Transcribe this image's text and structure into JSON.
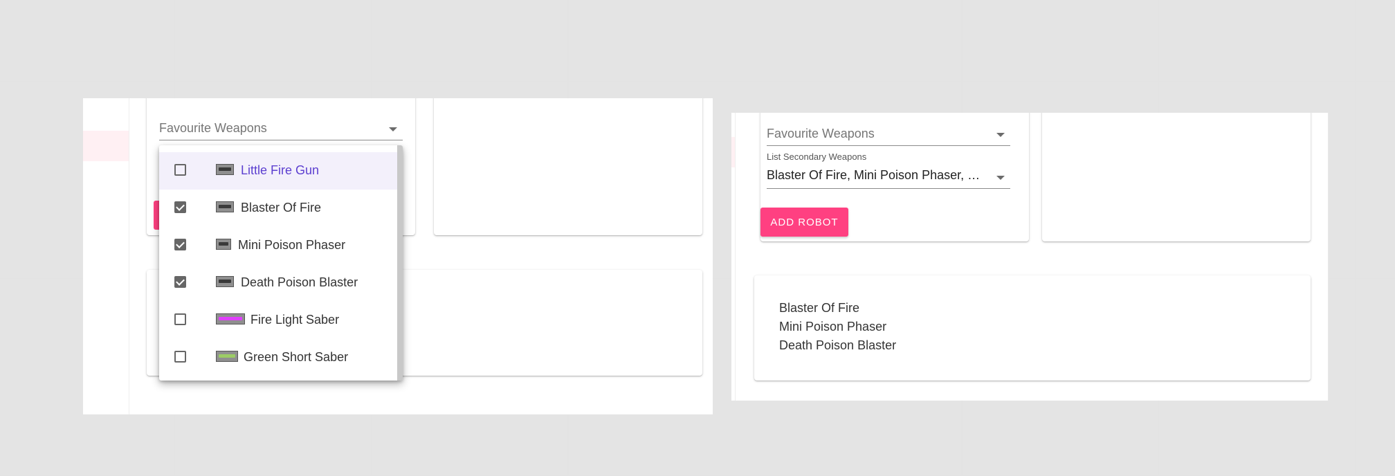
{
  "left_view": {
    "favourite_label": "Favourite Weapons",
    "weapon_menu": {
      "items": [
        {
          "label": "Little Fire Gun",
          "checked": false,
          "icon": "gun-icon",
          "highlighted": true
        },
        {
          "label": "Blaster Of Fire",
          "checked": true,
          "icon": "blaster-icon",
          "highlighted": false
        },
        {
          "label": "Mini Poison Phaser",
          "checked": true,
          "icon": "phaser-icon",
          "highlighted": false
        },
        {
          "label": "Death Poison Blaster",
          "checked": true,
          "icon": "blaster-icon",
          "highlighted": false
        },
        {
          "label": "Fire Light Saber",
          "checked": false,
          "icon": "pink-saber-icon",
          "highlighted": false
        },
        {
          "label": "Green Short Saber",
          "checked": false,
          "icon": "green-saber-icon",
          "highlighted": false
        }
      ]
    }
  },
  "right_view": {
    "favourite_label": "Favourite Weapons",
    "secondary_label": "List Secondary Weapons",
    "secondary_value": "Blaster Of Fire, Mini Poison Phaser, Death Poison Blaster",
    "add_button": "ADD ROBOT",
    "selected_list": [
      "Blaster Of Fire",
      "Mini Poison Phaser",
      "Death Poison Blaster"
    ]
  },
  "colors": {
    "accent": "#ff4081",
    "highlight_text": "#5c3fd0",
    "highlight_bg": "#f3f0fb"
  }
}
